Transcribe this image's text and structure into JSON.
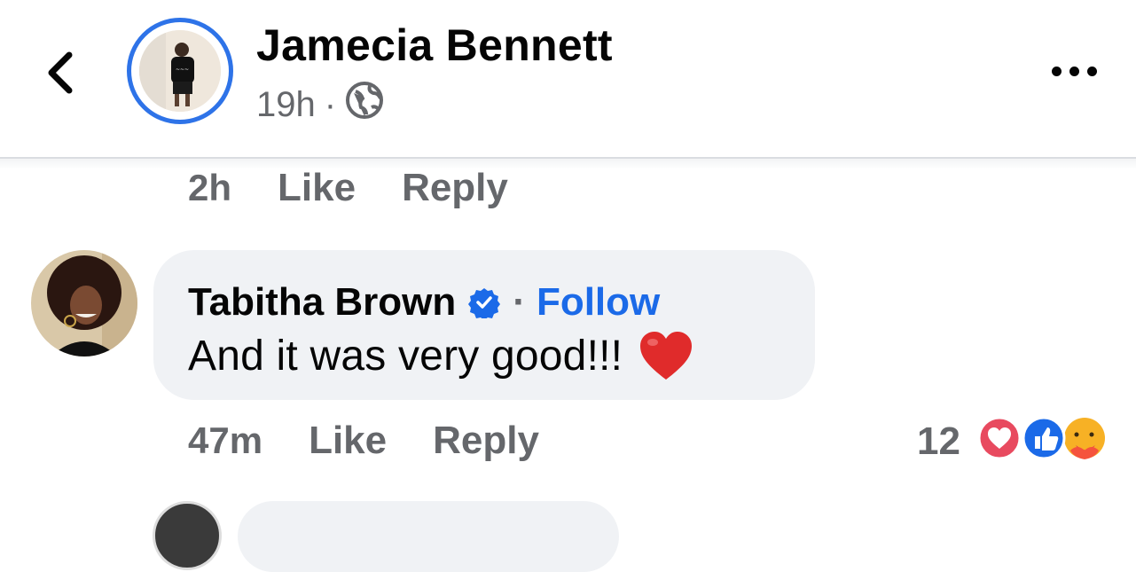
{
  "post": {
    "author": "Jamecia Bennett",
    "time": "19h",
    "separator": "·",
    "privacy_icon": "globe-icon"
  },
  "header": {
    "back_icon": "chevron-left-icon",
    "more_icon": "more-horizontal-icon"
  },
  "previous_comment": {
    "time": "2h",
    "like_label": "Like",
    "reply_label": "Reply"
  },
  "comment": {
    "author": "Tabitha Brown",
    "verified_icon": "verified-badge-icon",
    "separator": "·",
    "follow_label": "Follow",
    "text": "And it was very good!!!",
    "emoji": "❤️",
    "time": "47m",
    "like_label": "Like",
    "reply_label": "Reply",
    "reaction_count": "12",
    "reactions": [
      "love-reaction-icon",
      "like-reaction-icon",
      "care-reaction-icon"
    ]
  },
  "colors": {
    "accent": "#1b6ae8",
    "muted": "#65676b",
    "bubble": "#f0f2f5"
  }
}
